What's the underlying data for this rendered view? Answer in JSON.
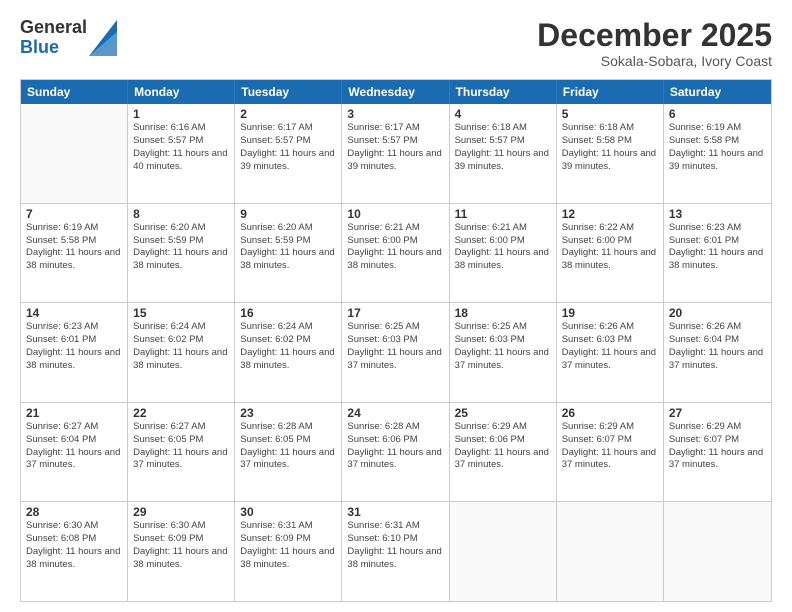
{
  "logo": {
    "general": "General",
    "blue": "Blue"
  },
  "header": {
    "month": "December 2025",
    "location": "Sokala-Sobara, Ivory Coast"
  },
  "weekdays": [
    "Sunday",
    "Monday",
    "Tuesday",
    "Wednesday",
    "Thursday",
    "Friday",
    "Saturday"
  ],
  "weeks": [
    [
      {
        "day": "",
        "sunrise": "",
        "sunset": "",
        "daylight": ""
      },
      {
        "day": "1",
        "sunrise": "Sunrise: 6:16 AM",
        "sunset": "Sunset: 5:57 PM",
        "daylight": "Daylight: 11 hours and 40 minutes."
      },
      {
        "day": "2",
        "sunrise": "Sunrise: 6:17 AM",
        "sunset": "Sunset: 5:57 PM",
        "daylight": "Daylight: 11 hours and 39 minutes."
      },
      {
        "day": "3",
        "sunrise": "Sunrise: 6:17 AM",
        "sunset": "Sunset: 5:57 PM",
        "daylight": "Daylight: 11 hours and 39 minutes."
      },
      {
        "day": "4",
        "sunrise": "Sunrise: 6:18 AM",
        "sunset": "Sunset: 5:57 PM",
        "daylight": "Daylight: 11 hours and 39 minutes."
      },
      {
        "day": "5",
        "sunrise": "Sunrise: 6:18 AM",
        "sunset": "Sunset: 5:58 PM",
        "daylight": "Daylight: 11 hours and 39 minutes."
      },
      {
        "day": "6",
        "sunrise": "Sunrise: 6:19 AM",
        "sunset": "Sunset: 5:58 PM",
        "daylight": "Daylight: 11 hours and 39 minutes."
      }
    ],
    [
      {
        "day": "7",
        "sunrise": "Sunrise: 6:19 AM",
        "sunset": "Sunset: 5:58 PM",
        "daylight": "Daylight: 11 hours and 38 minutes."
      },
      {
        "day": "8",
        "sunrise": "Sunrise: 6:20 AM",
        "sunset": "Sunset: 5:59 PM",
        "daylight": "Daylight: 11 hours and 38 minutes."
      },
      {
        "day": "9",
        "sunrise": "Sunrise: 6:20 AM",
        "sunset": "Sunset: 5:59 PM",
        "daylight": "Daylight: 11 hours and 38 minutes."
      },
      {
        "day": "10",
        "sunrise": "Sunrise: 6:21 AM",
        "sunset": "Sunset: 6:00 PM",
        "daylight": "Daylight: 11 hours and 38 minutes."
      },
      {
        "day": "11",
        "sunrise": "Sunrise: 6:21 AM",
        "sunset": "Sunset: 6:00 PM",
        "daylight": "Daylight: 11 hours and 38 minutes."
      },
      {
        "day": "12",
        "sunrise": "Sunrise: 6:22 AM",
        "sunset": "Sunset: 6:00 PM",
        "daylight": "Daylight: 11 hours and 38 minutes."
      },
      {
        "day": "13",
        "sunrise": "Sunrise: 6:23 AM",
        "sunset": "Sunset: 6:01 PM",
        "daylight": "Daylight: 11 hours and 38 minutes."
      }
    ],
    [
      {
        "day": "14",
        "sunrise": "Sunrise: 6:23 AM",
        "sunset": "Sunset: 6:01 PM",
        "daylight": "Daylight: 11 hours and 38 minutes."
      },
      {
        "day": "15",
        "sunrise": "Sunrise: 6:24 AM",
        "sunset": "Sunset: 6:02 PM",
        "daylight": "Daylight: 11 hours and 38 minutes."
      },
      {
        "day": "16",
        "sunrise": "Sunrise: 6:24 AM",
        "sunset": "Sunset: 6:02 PM",
        "daylight": "Daylight: 11 hours and 38 minutes."
      },
      {
        "day": "17",
        "sunrise": "Sunrise: 6:25 AM",
        "sunset": "Sunset: 6:03 PM",
        "daylight": "Daylight: 11 hours and 37 minutes."
      },
      {
        "day": "18",
        "sunrise": "Sunrise: 6:25 AM",
        "sunset": "Sunset: 6:03 PM",
        "daylight": "Daylight: 11 hours and 37 minutes."
      },
      {
        "day": "19",
        "sunrise": "Sunrise: 6:26 AM",
        "sunset": "Sunset: 6:03 PM",
        "daylight": "Daylight: 11 hours and 37 minutes."
      },
      {
        "day": "20",
        "sunrise": "Sunrise: 6:26 AM",
        "sunset": "Sunset: 6:04 PM",
        "daylight": "Daylight: 11 hours and 37 minutes."
      }
    ],
    [
      {
        "day": "21",
        "sunrise": "Sunrise: 6:27 AM",
        "sunset": "Sunset: 6:04 PM",
        "daylight": "Daylight: 11 hours and 37 minutes."
      },
      {
        "day": "22",
        "sunrise": "Sunrise: 6:27 AM",
        "sunset": "Sunset: 6:05 PM",
        "daylight": "Daylight: 11 hours and 37 minutes."
      },
      {
        "day": "23",
        "sunrise": "Sunrise: 6:28 AM",
        "sunset": "Sunset: 6:05 PM",
        "daylight": "Daylight: 11 hours and 37 minutes."
      },
      {
        "day": "24",
        "sunrise": "Sunrise: 6:28 AM",
        "sunset": "Sunset: 6:06 PM",
        "daylight": "Daylight: 11 hours and 37 minutes."
      },
      {
        "day": "25",
        "sunrise": "Sunrise: 6:29 AM",
        "sunset": "Sunset: 6:06 PM",
        "daylight": "Daylight: 11 hours and 37 minutes."
      },
      {
        "day": "26",
        "sunrise": "Sunrise: 6:29 AM",
        "sunset": "Sunset: 6:07 PM",
        "daylight": "Daylight: 11 hours and 37 minutes."
      },
      {
        "day": "27",
        "sunrise": "Sunrise: 6:29 AM",
        "sunset": "Sunset: 6:07 PM",
        "daylight": "Daylight: 11 hours and 37 minutes."
      }
    ],
    [
      {
        "day": "28",
        "sunrise": "Sunrise: 6:30 AM",
        "sunset": "Sunset: 6:08 PM",
        "daylight": "Daylight: 11 hours and 38 minutes."
      },
      {
        "day": "29",
        "sunrise": "Sunrise: 6:30 AM",
        "sunset": "Sunset: 6:09 PM",
        "daylight": "Daylight: 11 hours and 38 minutes."
      },
      {
        "day": "30",
        "sunrise": "Sunrise: 6:31 AM",
        "sunset": "Sunset: 6:09 PM",
        "daylight": "Daylight: 11 hours and 38 minutes."
      },
      {
        "day": "31",
        "sunrise": "Sunrise: 6:31 AM",
        "sunset": "Sunset: 6:10 PM",
        "daylight": "Daylight: 11 hours and 38 minutes."
      },
      {
        "day": "",
        "sunrise": "",
        "sunset": "",
        "daylight": ""
      },
      {
        "day": "",
        "sunrise": "",
        "sunset": "",
        "daylight": ""
      },
      {
        "day": "",
        "sunrise": "",
        "sunset": "",
        "daylight": ""
      }
    ]
  ]
}
